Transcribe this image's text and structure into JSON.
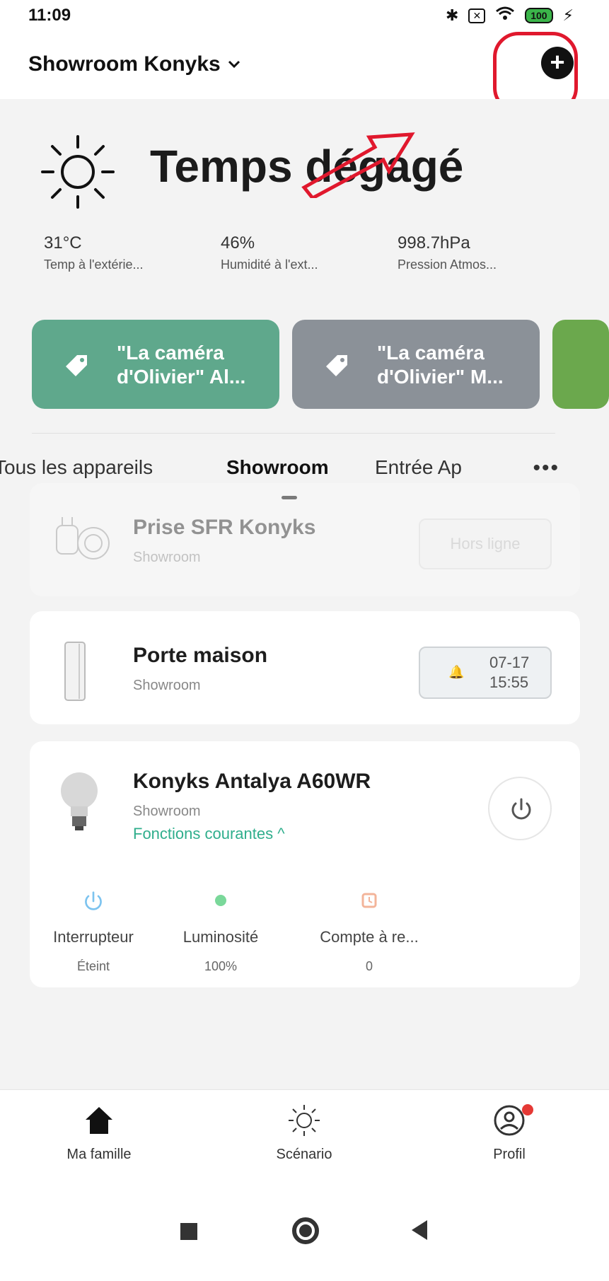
{
  "status_bar": {
    "time": "11:09",
    "battery": "100",
    "icons": [
      "bluetooth-icon",
      "close-box-icon",
      "wifi-icon",
      "battery-icon",
      "charging-icon"
    ]
  },
  "header": {
    "home_name": "Showroom Konyks",
    "add_icon": "plus-icon"
  },
  "weather": {
    "condition": "Temps dégagé",
    "icon": "sun-icon"
  },
  "stats": [
    {
      "value": "31°C",
      "label": "Temp à l'extérie..."
    },
    {
      "value": "46%",
      "label": "Humidité à l'ext..."
    },
    {
      "value": "998.7hPa",
      "label": "Pression Atmos..."
    }
  ],
  "scenes": [
    {
      "line1": "\"La caméra",
      "line2": "d'Olivier\" Al...",
      "color": "#5fa88c"
    },
    {
      "line1": "\"La caméra",
      "line2": "d'Olivier\" M...",
      "color": "#8b9198"
    },
    {
      "line1": "",
      "line2": "",
      "color": "#6ba84d"
    }
  ],
  "tabs": [
    {
      "label": "Tous les appareils"
    },
    {
      "label": "Showroom"
    },
    {
      "label": "Entrée Ap"
    },
    {
      "label": "•••"
    }
  ],
  "devices": [
    {
      "name": "Prise SFR Konyks",
      "room": "Showroom",
      "status": "Hors ligne"
    },
    {
      "name": "Porte maison",
      "room": "Showroom",
      "alert_date": "07-17",
      "alert_time": "15:55"
    },
    {
      "name": "Konyks Antalya A60WR",
      "room": "Showroom",
      "functions_link": "Fonctions courantes ^",
      "controls": [
        {
          "label": "Interrupteur",
          "value": "Éteint",
          "color": "#7cc3ef"
        },
        {
          "label": "Luminosité",
          "value": "100%",
          "color": "#7ad89a"
        },
        {
          "label": "Compte à re...",
          "value": "0",
          "color": "#f3b49a"
        }
      ]
    }
  ],
  "bottom_nav": [
    {
      "label": "Ma famille",
      "icon": "home-icon"
    },
    {
      "label": "Scénario",
      "icon": "sun-outline-icon"
    },
    {
      "label": "Profil",
      "icon": "profile-icon"
    }
  ]
}
